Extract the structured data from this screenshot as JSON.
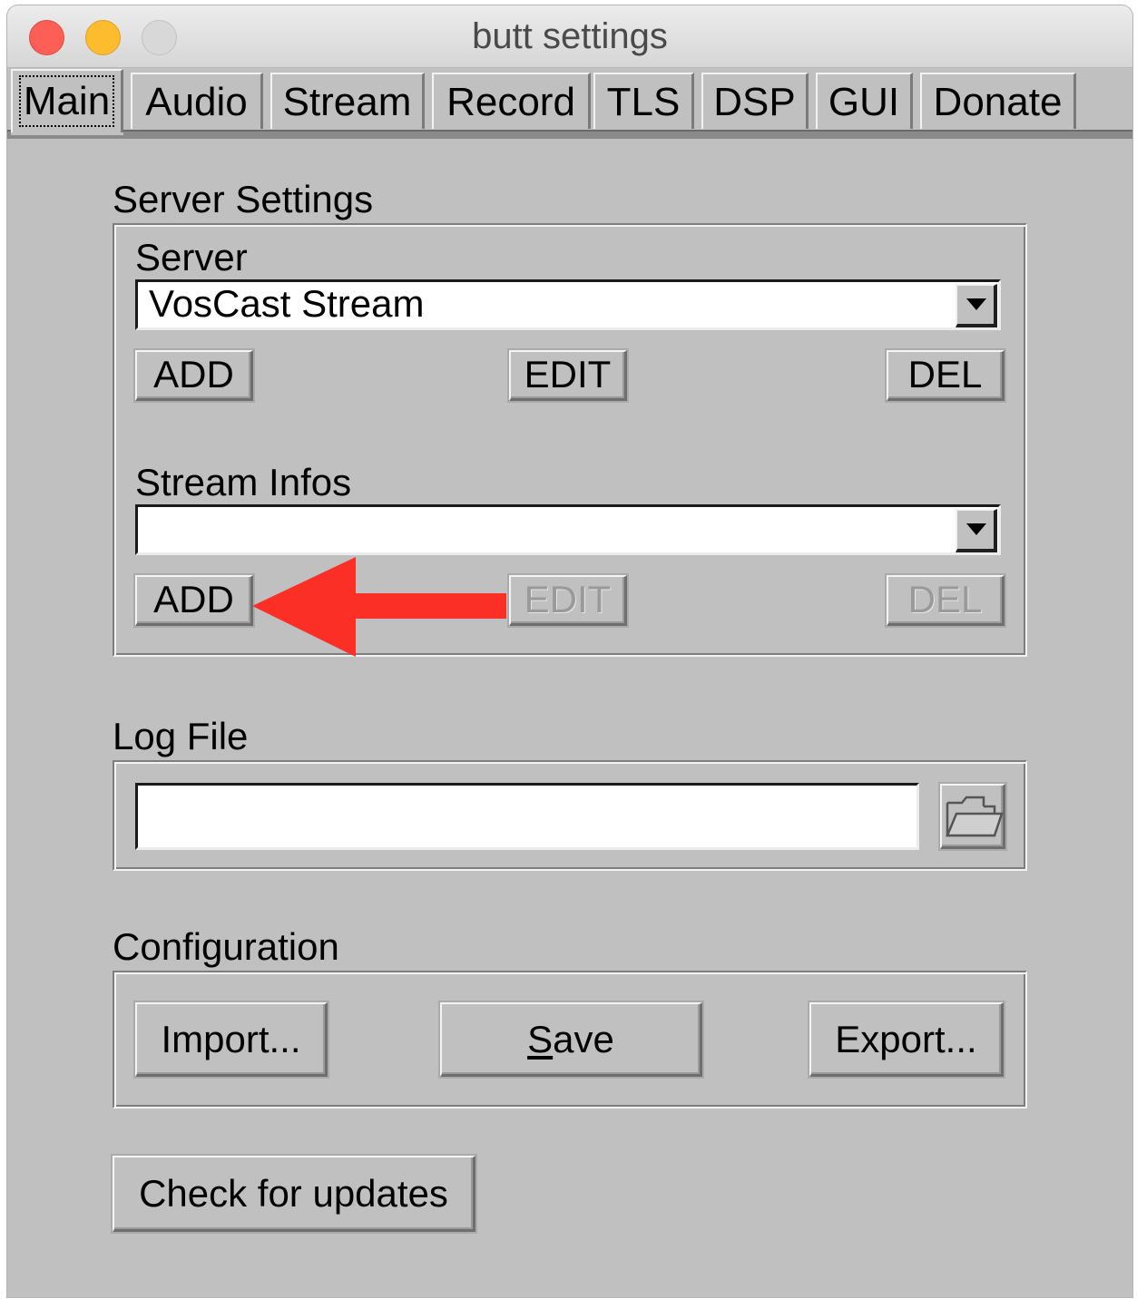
{
  "window": {
    "title": "butt settings"
  },
  "tabs": [
    {
      "label": "Main",
      "active": true
    },
    {
      "label": "Audio"
    },
    {
      "label": "Stream"
    },
    {
      "label": "Record"
    },
    {
      "label": "TLS"
    },
    {
      "label": "DSP"
    },
    {
      "label": "GUI"
    },
    {
      "label": "Donate"
    }
  ],
  "server_settings": {
    "title": "Server Settings",
    "server_label": "Server",
    "server_value": "VosCast Stream",
    "server_buttons": {
      "add": "ADD",
      "edit": "EDIT",
      "del": "DEL"
    },
    "stream_infos_label": "Stream Infos",
    "stream_infos_value": "",
    "stream_infos_buttons": {
      "add": "ADD",
      "edit": "EDIT",
      "del": "DEL"
    }
  },
  "log_file": {
    "title": "Log File",
    "value": ""
  },
  "configuration": {
    "title": "Configuration",
    "import_label": "Import...",
    "save_label": "Save",
    "export_label": "Export..."
  },
  "updates_label": "Check for updates",
  "annotation": {
    "arrow_color": "#fb2f26"
  },
  "icons": [
    "folder-icon",
    "dropdown-arrow-icon"
  ]
}
